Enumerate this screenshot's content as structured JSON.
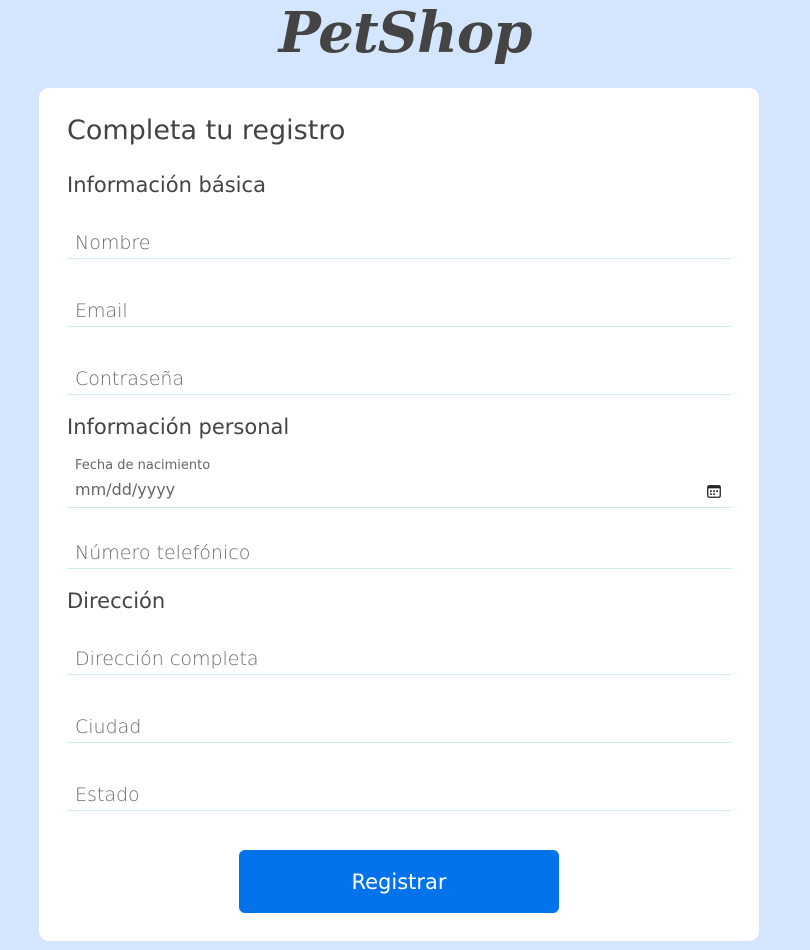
{
  "brand": {
    "logo_text": "PetShop"
  },
  "form": {
    "title": "Completa tu registro",
    "sections": {
      "basic": "Información básica",
      "personal": "Información personal",
      "address": "Dirección"
    },
    "fields": {
      "nombre": {
        "placeholder": "Nombre",
        "value": ""
      },
      "email": {
        "placeholder": "Email",
        "value": ""
      },
      "password": {
        "placeholder": "Contraseña",
        "value": ""
      },
      "birthdate": {
        "label": "Fecha de nacimiento",
        "value": "mm/dd/yyyy"
      },
      "phone": {
        "placeholder": "Número telefónico",
        "value": ""
      },
      "address_full": {
        "placeholder": "Dirección completa",
        "value": ""
      },
      "city": {
        "placeholder": "Ciudad",
        "value": ""
      },
      "state": {
        "placeholder": "Estado",
        "value": ""
      }
    },
    "submit_label": "Registrar"
  },
  "icons": {
    "calendar": "calendar-icon"
  },
  "colors": {
    "background": "#d3e6fd",
    "card": "#ffffff",
    "accent": "#0373ec",
    "text": "#444444",
    "field_border": "#cfeee9"
  }
}
